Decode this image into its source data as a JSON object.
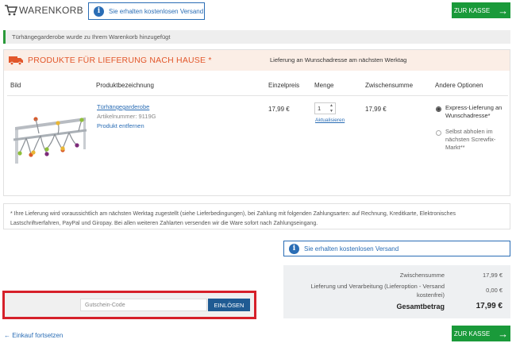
{
  "header": {
    "title": "WARENKORB",
    "free_shipping": "Sie erhalten kostenlosen Versand",
    "checkout_label": "ZUR KASSE"
  },
  "notice": "Türhängegarderobe wurde zu Ihrem Warenkorb hinzugefügt",
  "delivery": {
    "title": "PRODUKTE FÜR LIEFERUNG NACH HAUSE *",
    "subtitle": "Lieferung an Wunschadresse am nächsten Werktag",
    "columns": {
      "image": "Bild",
      "name": "Produktbezeichnung",
      "unit_price": "Einzelpreis",
      "quantity": "Menge",
      "subtotal": "Zwischensumme",
      "options": "Andere Optionen"
    },
    "item": {
      "name": "Türhängegarderobe",
      "article": "Artikelnummer: 9119G",
      "remove": "Produkt entfernen",
      "price": "17,99 €",
      "quantity": "1",
      "update": "Aktualisieren",
      "subtotal": "17,99 €",
      "option_express": "Express-Lieferung an Wunschadresse*",
      "option_pickup": "Selbst abholen im nächsten Screwfix-Markt**"
    }
  },
  "info_text": "* Ihre Lieferung wird voraussichtlich am nächsten Werktag zugestellt (siehe Lieferbedingungen), bei Zahlung mit folgenden Zahlungsarten: auf Rechnung, Kreditkarte, Elektronisches Lastschriftverfahren, PayPal und Giropay. Bei allen weiteren Zahlarten versenden wir die Ware sofort nach Zahlungseingang.",
  "free_shipping_bottom": "Sie erhalten kostenlosen Versand",
  "summary": {
    "subtotal_label": "Zwischensumme",
    "subtotal_value": "17,99 €",
    "delivery_label": "Lieferung und Verarbeitung (Lieferoption - Versand kostenfrei)",
    "delivery_value": "0,00 €",
    "total_label": "Gesamtbetrag",
    "total_value": "17,99 €"
  },
  "coupon": {
    "placeholder": "Gutschein-Code",
    "button": "EINLÖSEN"
  },
  "continue_label": "Einkauf fortsetzen",
  "colors": {
    "green": "#1a9a3a",
    "blue": "#2a6db5",
    "orange": "#e2572b",
    "dark_blue": "#1f5b93",
    "highlight_red": "#d6202a"
  }
}
